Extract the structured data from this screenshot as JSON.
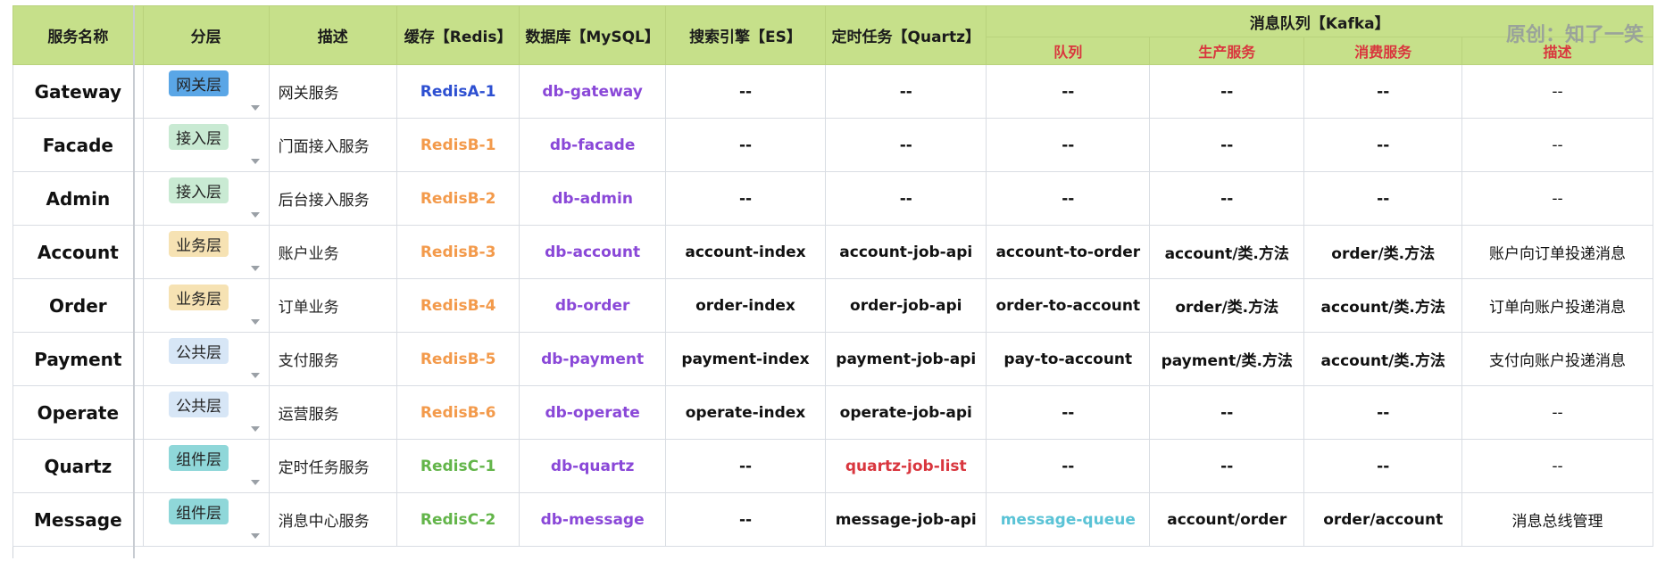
{
  "headers": {
    "service_name": "服务名称",
    "layer": "分层",
    "description": "描述",
    "cache": "缓存【Redis】",
    "database": "数据库【MySQL】",
    "search": "搜索引擎【ES】",
    "scheduler": "定时任务【Quartz】",
    "kafka_group": "消息队列【Kafka】",
    "kafka_queue": "队列",
    "kafka_producer": "生产服务",
    "kafka_consumer": "消费服务",
    "kafka_desc": "描述",
    "watermark": "原创：知了一笑"
  },
  "colors": {
    "header_bg": "#c6e08a",
    "redisA": "#2d4fd1",
    "redisB": "#f39a4b",
    "redisC": "#63b54a",
    "db": "#8a48d8",
    "quartz_highlight": "#d9363e",
    "queue_highlight": "#5ac3d6",
    "layer_gateway": "#5aa6e6",
    "layer_access": "#c9ead3",
    "layer_business": "#f6e2b3",
    "layer_public": "#d7e6f6",
    "layer_component": "#8fd7d9"
  },
  "rows": [
    {
      "service": "Gateway",
      "layer": "网关层",
      "layer_style": "gateway",
      "desc": "网关服务",
      "redis": "RedisA-1",
      "redis_style": "redisA",
      "db": "db-gateway",
      "es": "--",
      "quartz": "--",
      "queue": "--",
      "producer": "--",
      "consumer": "--",
      "kdesc": "--"
    },
    {
      "service": "Facade",
      "layer": "接入层",
      "layer_style": "access",
      "desc": "门面接入服务",
      "redis": "RedisB-1",
      "redis_style": "redisB",
      "db": "db-facade",
      "es": "--",
      "quartz": "--",
      "queue": "--",
      "producer": "--",
      "consumer": "--",
      "kdesc": "--"
    },
    {
      "service": "Admin",
      "layer": "接入层",
      "layer_style": "access",
      "desc": "后台接入服务",
      "redis": "RedisB-2",
      "redis_style": "redisB",
      "db": "db-admin",
      "es": "--",
      "quartz": "--",
      "queue": "--",
      "producer": "--",
      "consumer": "--",
      "kdesc": "--"
    },
    {
      "service": "Account",
      "layer": "业务层",
      "layer_style": "business",
      "desc": "账户业务",
      "redis": "RedisB-3",
      "redis_style": "redisB",
      "db": "db-account",
      "es": "account-index",
      "quartz": "account-job-api",
      "queue": "account-to-order",
      "producer": "account/类.方法",
      "consumer": "order/类.方法",
      "kdesc": "账户向订单投递消息"
    },
    {
      "service": "Order",
      "layer": "业务层",
      "layer_style": "business",
      "desc": "订单业务",
      "redis": "RedisB-4",
      "redis_style": "redisB",
      "db": "db-order",
      "es": "order-index",
      "quartz": "order-job-api",
      "queue": "order-to-account",
      "producer": "order/类.方法",
      "consumer": "account/类.方法",
      "kdesc": "订单向账户投递消息"
    },
    {
      "service": "Payment",
      "layer": "公共层",
      "layer_style": "public",
      "desc": "支付服务",
      "redis": "RedisB-5",
      "redis_style": "redisB",
      "db": "db-payment",
      "es": "payment-index",
      "quartz": "payment-job-api",
      "queue": "pay-to-account",
      "producer": "payment/类.方法",
      "consumer": "account/类.方法",
      "kdesc": "支付向账户投递消息"
    },
    {
      "service": "Operate",
      "layer": "公共层",
      "layer_style": "public",
      "desc": "运营服务",
      "redis": "RedisB-6",
      "redis_style": "redisB",
      "db": "db-operate",
      "es": "operate-index",
      "quartz": "operate-job-api",
      "queue": "--",
      "producer": "--",
      "consumer": "--",
      "kdesc": "--"
    },
    {
      "service": "Quartz",
      "layer": "组件层",
      "layer_style": "component",
      "desc": "定时任务服务",
      "redis": "RedisC-1",
      "redis_style": "redisC",
      "db": "db-quartz",
      "es": "--",
      "quartz": "quartz-job-list",
      "quartz_style": "quartz",
      "queue": "--",
      "producer": "--",
      "consumer": "--",
      "kdesc": "--"
    },
    {
      "service": "Message",
      "layer": "组件层",
      "layer_style": "component",
      "desc": "消息中心服务",
      "redis": "RedisC-2",
      "redis_style": "redisC",
      "db": "db-message",
      "es": "--",
      "quartz": "message-job-api",
      "queue": "message-queue",
      "queue_style": "queue-special",
      "producer": "account/order",
      "consumer": "order/account",
      "kdesc": "消息总线管理"
    }
  ]
}
